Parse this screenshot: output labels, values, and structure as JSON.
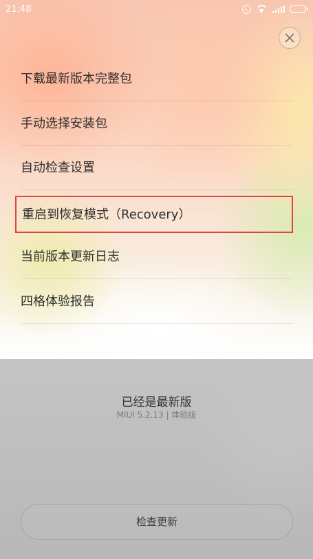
{
  "status_bar": {
    "time": "21:48",
    "icons": [
      "alarm-icon",
      "wifi-icon",
      "signal-icon",
      "battery-icon"
    ]
  },
  "close_button": {
    "icon": "close-icon"
  },
  "menu": {
    "items": [
      {
        "label": "下载最新版本完整包"
      },
      {
        "label": "手动选择安装包"
      },
      {
        "label": "自动检查设置"
      },
      {
        "label": "重启到恢复模式（Recovery）",
        "highlighted": true
      },
      {
        "label": "当前版本更新日志"
      },
      {
        "label": "四格体验报告"
      }
    ]
  },
  "update_status": {
    "title": "已经是最新版",
    "version": "MIUI 5.2.13 | 体验版"
  },
  "check_button": {
    "label": "检查更新"
  },
  "colors": {
    "highlight_border": "#e84040",
    "text_primary": "#2e2e2e",
    "lower_background": "#bdbdbd"
  }
}
